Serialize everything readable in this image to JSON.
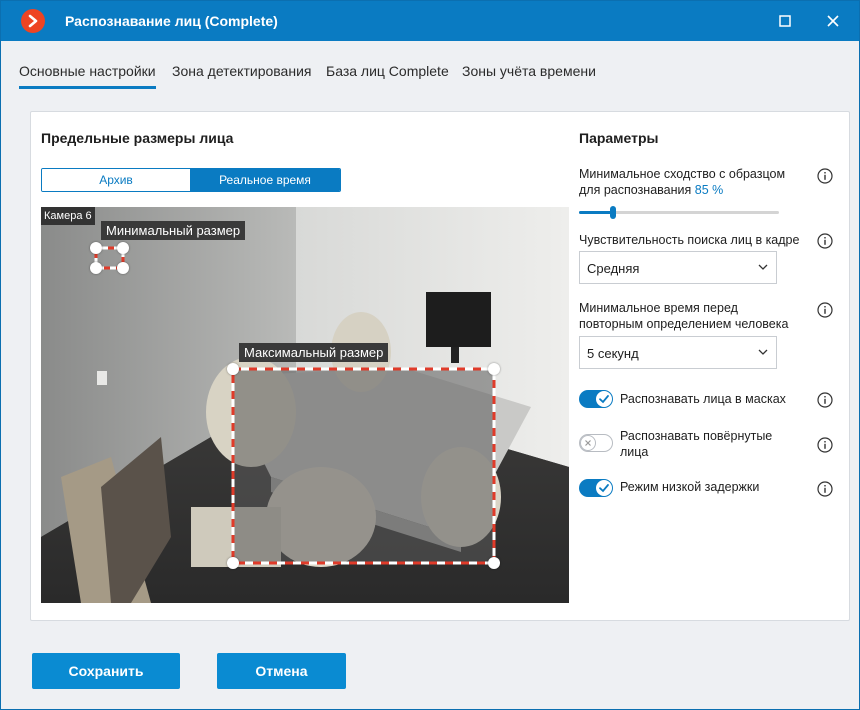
{
  "window": {
    "title": "Распознавание лиц (Complete)"
  },
  "tabs": [
    {
      "label": "Основные настройки",
      "active": true
    },
    {
      "label": "Зона детектирования",
      "active": false
    },
    {
      "label": "База лиц Complete",
      "active": false
    },
    {
      "label": "Зоны учёта времени",
      "active": false
    }
  ],
  "face_sizes": {
    "title": "Предельные размеры лица",
    "mode_archive": "Архив",
    "mode_realtime": "Реальное время",
    "camera_label": "Камера 6",
    "min_size_label": "Минимальный размер",
    "max_size_label": "Максимальный размер"
  },
  "params": {
    "title": "Параметры",
    "similarity_label_line1": "Минимальное сходство с образцом",
    "similarity_label_line2": "для распознавания",
    "similarity_value": "85",
    "similarity_unit": "%",
    "similarity_fraction": 0.85,
    "sensitivity_label": "Чувствительность поиска лиц в кадре",
    "sensitivity_value": "Средняя",
    "min_time_label_line1": "Минимальное время перед",
    "min_time_label_line2": "повторным определением человека",
    "min_time_value": "5 секунд",
    "toggle_masks_label": "Распознавать лица в масках",
    "toggle_masks_on": true,
    "toggle_rotated_label_line1": "Распознавать повёрнутые",
    "toggle_rotated_label_line2": "лица",
    "toggle_rotated_on": false,
    "toggle_low_latency_label": "Режим низкой задержки",
    "toggle_low_latency_on": true
  },
  "footer": {
    "save_label": "Сохранить",
    "cancel_label": "Отмена"
  },
  "colors": {
    "accent": "#0a7bc2",
    "logo": "#ee4423",
    "frame_dash_red": "#e03b2a"
  },
  "icons": {
    "logo": "app-logo-icon",
    "maximize": "maximize-icon",
    "close": "close-icon",
    "info": "info-icon",
    "chevron": "chevron-down-icon",
    "check": "check-icon"
  }
}
